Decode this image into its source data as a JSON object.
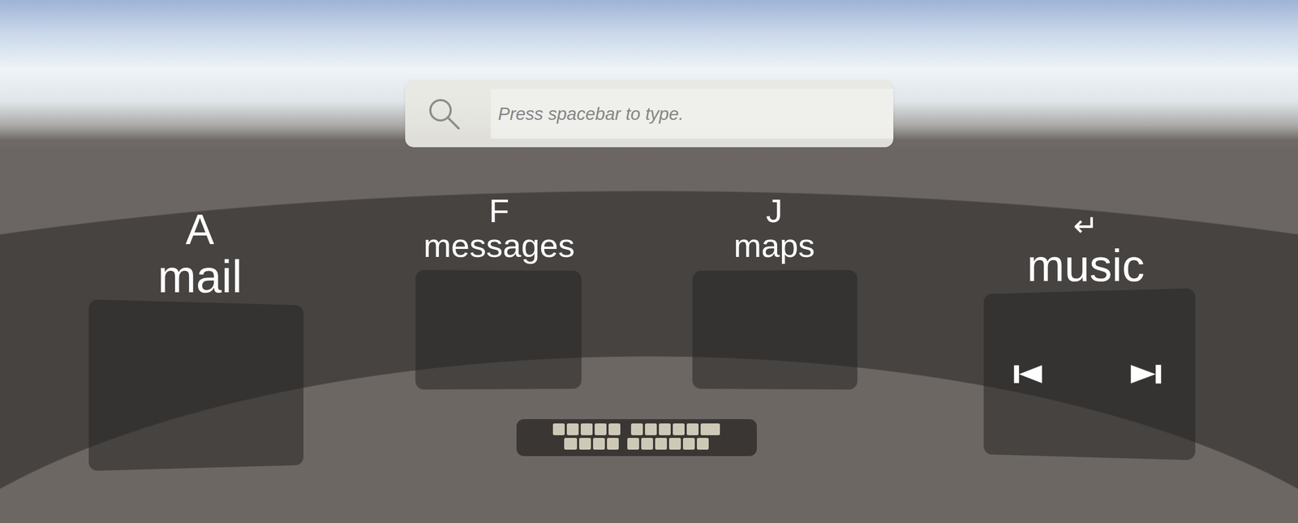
{
  "search": {
    "placeholder": "Press spacebar to type."
  },
  "apps": [
    {
      "key": "A",
      "label": "mail",
      "kind": "empty"
    },
    {
      "key": "F",
      "label": "messages",
      "kind": "empty"
    },
    {
      "key": "J",
      "label": "maps",
      "kind": "empty"
    },
    {
      "key": "↵",
      "label": "music",
      "kind": "player"
    }
  ]
}
